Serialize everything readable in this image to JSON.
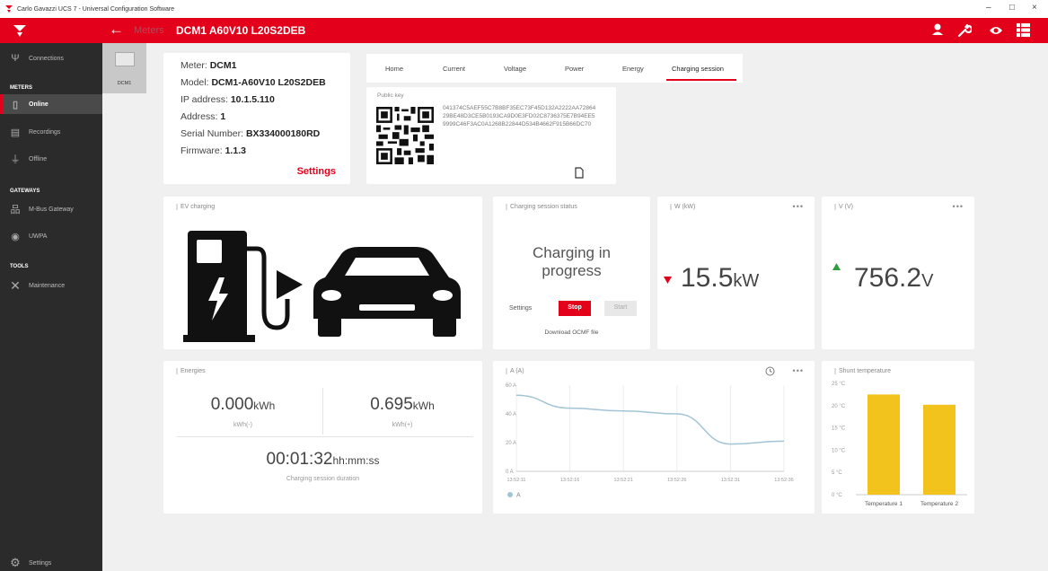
{
  "window": {
    "title": "Carlo Gavazzi UCS 7 - Universal Configuration Software",
    "minimize": "–",
    "maximize": "□",
    "close": "×"
  },
  "header": {
    "crumb_prev": "Meters",
    "crumb_current": "DCM1 A60V10 L20S2DEB",
    "icons": [
      "user-icon",
      "wrench-icon",
      "eye-icon",
      "menu-icon"
    ]
  },
  "sidebar": {
    "connections": "Connections",
    "meters_section": "METERS",
    "online": "Online",
    "recordings": "Recordings",
    "offline": "Offline",
    "gateways_section": "GATEWAYS",
    "mbus_gateway": "M-Bus Gateway",
    "uwp": "UWPA",
    "tools_section": "TOOLS",
    "maintenance": "Maintenance",
    "settings": "Settings"
  },
  "meter_list": {
    "items": [
      {
        "label": "DCM1"
      }
    ]
  },
  "meter_info": {
    "meter_label": "Meter: ",
    "meter": "DCM1",
    "model_label": "Model: ",
    "model": "DCM1-A60V10 L20S2DEB",
    "ip_label": "IP address: ",
    "ip": "10.1.5.110",
    "address_label": "Address: ",
    "address": "1",
    "serial_label": "Serial Number: ",
    "serial": "BX334000180RD",
    "firmware_label": "Firmware: ",
    "firmware": "1.1.3",
    "settings": "Settings"
  },
  "tabs": [
    {
      "label": "Home"
    },
    {
      "label": "Current"
    },
    {
      "label": "Voltage"
    },
    {
      "label": "Power"
    },
    {
      "label": "Energy"
    },
    {
      "label": "Charging session"
    }
  ],
  "public_key": {
    "title": "Public key",
    "value": "041374C5AEF55C7B8BF35EC73F45D132A2222AA7286429BE48D3CE5B0193CA9D0E3FD02C8736375E7B94EE59999C46F3AC0A1268B22844D534B4662F915B66DC70"
  },
  "ev_charging": {
    "title": "EV charging"
  },
  "session_status": {
    "title": "Charging session status",
    "status_line1": "Charging in",
    "status_line2": "progress",
    "settings_label": "Settings",
    "stop": "Stop",
    "start": "Start",
    "download": "Download OCMF file"
  },
  "power": {
    "title": "W (kW)",
    "value": "15.5",
    "unit": "kW",
    "trend": "down",
    "trend_color": "#e3001b"
  },
  "voltage": {
    "title": "V (V)",
    "value": "756.2",
    "unit": "V",
    "trend": "up",
    "trend_color": "#2e9e3e"
  },
  "energies": {
    "title": "Energies",
    "neg_value": "0.000",
    "neg_unit": "kWh",
    "neg_label": "kWh(-)",
    "pos_value": "0.695",
    "pos_unit": "kWh",
    "pos_label": "kWh(+)",
    "duration_value": "00:01:32",
    "duration_unit": "hh:mm:ss",
    "duration_label": "Charging session duration"
  },
  "current": {
    "title": "A (A)",
    "legend": "A"
  },
  "shunt": {
    "title": "Shunt temperature"
  },
  "colors": {
    "brand_red": "#e3001b",
    "line": "#a3c4d6",
    "bar": "#f2c31d"
  },
  "chart_data": [
    {
      "type": "line",
      "title": "A (A)",
      "x": [
        "13:52:11",
        "13:52:16",
        "13:52:21",
        "13:52:26",
        "13:52:31",
        "13:52:36"
      ],
      "series": [
        {
          "name": "A",
          "values": [
            53,
            44,
            42,
            40,
            19,
            21
          ]
        }
      ],
      "y_ticks": [
        "0 A",
        "20 A",
        "40 A",
        "60 A"
      ],
      "ylim": [
        0,
        60
      ],
      "grid": true,
      "legend": "bottom-left"
    },
    {
      "type": "bar",
      "title": "Shunt temperature",
      "categories": [
        "Temperature 1",
        "Temperature 2"
      ],
      "values": [
        22.5,
        20.2
      ],
      "y_ticks": [
        "0 °C",
        "5 °C",
        "10 °C",
        "15 °C",
        "20 °C",
        "25 °C"
      ],
      "ylim": [
        0,
        25
      ],
      "grid": false
    }
  ]
}
